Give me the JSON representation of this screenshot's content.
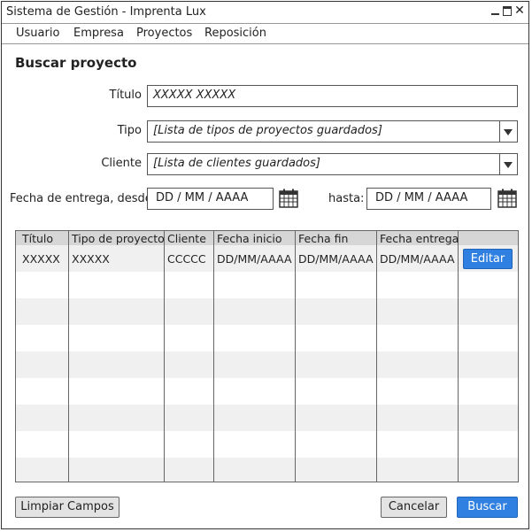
{
  "window": {
    "title": "Sistema de Gestión - Imprenta Lux",
    "close_symbol": "✕"
  },
  "menu": [
    "Usuario",
    "Empresa",
    "Proyectos",
    "Reposición"
  ],
  "page_title": "Buscar proyecto",
  "form": {
    "titulo_label": "Título",
    "titulo_value": "XXXXX XXXXX",
    "tipo_label": "Tipo",
    "tipo_value": "[Lista de tipos de proyectos guardados]",
    "cliente_label": "Cliente",
    "cliente_value": "[Lista de clientes guardados]",
    "fecha_desde_label": "Fecha de entrega, desde:",
    "fecha_desde_value": "DD / MM / AAAA",
    "hasta_label": "hasta:",
    "fecha_hasta_value": "DD / MM / AAAA"
  },
  "table": {
    "columns": [
      "Título",
      "Tipo de proyecto",
      "Cliente",
      "Fecha inicio",
      "Fecha fin",
      "Fecha entrega"
    ],
    "rows": [
      [
        "XXXXX",
        "XXXXX",
        "CCCCC",
        "DD/MM/AAAA",
        "DD/MM/AAAA",
        "DD/MM/AAAA"
      ]
    ],
    "edit_label": "Editar"
  },
  "buttons": {
    "clear": "Limpiar Campos",
    "cancel": "Cancelar",
    "search": "Buscar"
  },
  "colors": {
    "accent": "#2f80e0",
    "header_bg": "#d6d6d6",
    "alt_row": "#f0f0f0"
  },
  "icons": [
    "minimize-icon",
    "maximize-icon",
    "close-icon",
    "dropdown-arrow-icon",
    "calendar-icon"
  ]
}
